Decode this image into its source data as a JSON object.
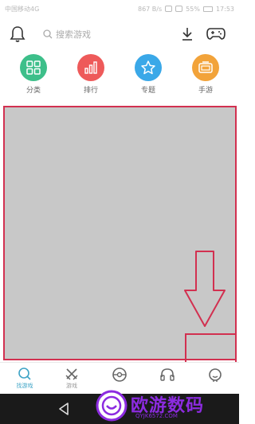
{
  "status_bar": {
    "carrier": "中国移动4G",
    "speed": "867 B/s",
    "battery": "55%",
    "time": "17:53"
  },
  "header": {
    "search_placeholder": "搜索游戏"
  },
  "categories": [
    {
      "label": "分类",
      "color": "#3dbf8a",
      "icon": "grid-icon"
    },
    {
      "label": "排行",
      "color": "#ee5a5a",
      "icon": "bar-chart-icon"
    },
    {
      "label": "专题",
      "color": "#3aa8e8",
      "icon": "star-icon"
    },
    {
      "label": "手游",
      "color": "#f2a33a",
      "icon": "handheld-game-icon"
    }
  ],
  "bottom_nav": [
    {
      "label": "找游戏",
      "icon": "search-icon",
      "active": true
    },
    {
      "label": "游戏",
      "icon": "crossed-swords-icon",
      "active": false
    },
    {
      "label": "",
      "icon": "disc-icon",
      "active": false
    },
    {
      "label": "",
      "icon": "headset-icon",
      "active": false
    },
    {
      "label": "",
      "icon": "smiley-icon",
      "active": false
    }
  ],
  "watermark": {
    "title": "欧游数码",
    "url": "QYJK6572.COM"
  },
  "colors": {
    "accent": "#3fa4c6",
    "annotation": "#d23050",
    "watermark": "#8c2be0"
  }
}
